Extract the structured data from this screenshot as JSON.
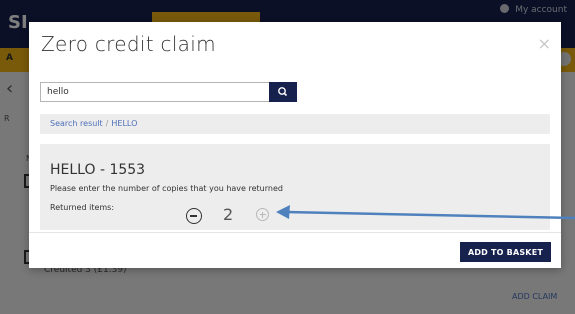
{
  "background": {
    "logo": "SI",
    "account": "My account",
    "subbar_letter": "A",
    "tab_letter": "R",
    "row_letter": "N",
    "credited": "Credited 3 (£1.39)",
    "add_claim": "ADD CLAIM"
  },
  "modal": {
    "title": "Zero credit claim",
    "close_label": "×",
    "search": {
      "value": "hello",
      "button_icon": "search-icon"
    },
    "breadcrumb": {
      "root": "Search result",
      "separator": "/",
      "current": "HELLO"
    },
    "result": {
      "title": "HELLO - 1553",
      "instructions": "Please enter the number of copies that you have returned",
      "returned_label": "Returned items:",
      "quantity": "2"
    },
    "add_to_basket": "ADD TO BASKET"
  },
  "colors": {
    "navy": "#16214e",
    "yellow": "#f2b417",
    "link_blue": "#4d6fb8",
    "arrow_blue": "#4f81bd"
  }
}
